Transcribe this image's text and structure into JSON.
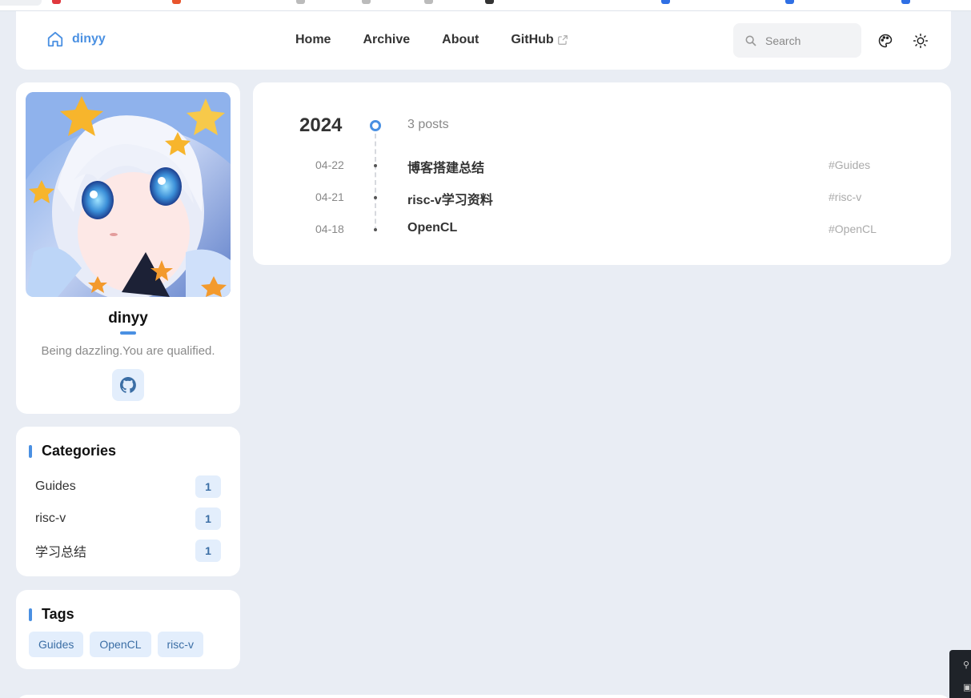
{
  "brand": {
    "name": "dinyy"
  },
  "nav": {
    "home": "Home",
    "archive": "Archive",
    "about": "About",
    "github": "GitHub"
  },
  "search": {
    "placeholder": "Search"
  },
  "profile": {
    "name": "dinyy",
    "bio": "Being dazzling.You are qualified."
  },
  "categories": {
    "title": "Categories",
    "items": [
      {
        "label": "Guides",
        "count": "1"
      },
      {
        "label": "risc-v",
        "count": "1"
      },
      {
        "label": "学习总结",
        "count": "1"
      }
    ]
  },
  "tags": {
    "title": "Tags",
    "items": [
      "Guides",
      "OpenCL",
      "risc-v"
    ]
  },
  "archive": {
    "year": "2024",
    "count_label": "3 posts",
    "posts": [
      {
        "date": "04-22",
        "title": "博客搭建总结",
        "tag": "#Guides"
      },
      {
        "date": "04-21",
        "title": "risc-v学习资料",
        "tag": "#risc-v"
      },
      {
        "date": "04-18",
        "title": "OpenCL",
        "tag": "#OpenCL"
      }
    ]
  },
  "colors": {
    "accent": "#4a90e2",
    "background": "#e9edf4",
    "badge_bg": "#e3eefc"
  }
}
